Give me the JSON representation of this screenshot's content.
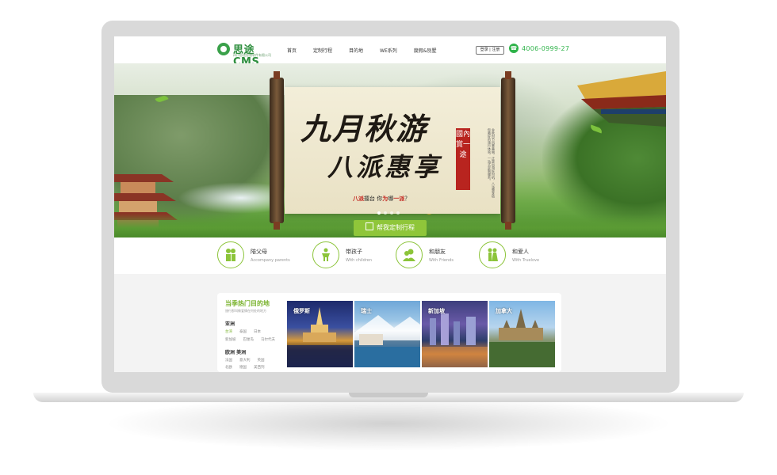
{
  "header": {
    "logo_text": "思途CMS",
    "logo_sub": "四川思途智旅软件有限公司",
    "nav": [
      "首页",
      "定制行程",
      "目的地",
      "WE系列",
      "度假&别墅"
    ],
    "login_label": "登录 | 注册",
    "phone": "4006-0999-27"
  },
  "banner": {
    "title_line1": "九月秋游",
    "title_line2": "八派惠享",
    "seal_text": "國內賞一途",
    "poem": "金秋时节风景美丽，正是出游好时机，八派惠享给你最好的旅行体验，一站式定制服务。",
    "tagline_prefix": "八派",
    "tagline_mid": "擂台   你",
    "tagline_red2": "为",
    "tagline_after": "哪",
    "tagline_red3": "一派",
    "tagline_end": "？",
    "cta_label": "帮我定制行程",
    "slide_count": 4,
    "active_slide": 1
  },
  "categories": [
    {
      "name": "陪父母",
      "sub": "Accompany parents",
      "icon": "parents-icon"
    },
    {
      "name": "带孩子",
      "sub": "With children",
      "icon": "child-icon"
    },
    {
      "name": "和朋友",
      "sub": "With Friends",
      "icon": "friends-icon"
    },
    {
      "name": "和爱人",
      "sub": "With Truelove",
      "icon": "couple-icon"
    }
  ],
  "hot": {
    "title": "当季热门目的地",
    "subtitle": "旅行那叫做爱情在何处的地方",
    "regions": [
      {
        "name": "亚洲",
        "rows": [
          [
            "台湾",
            "泰国",
            "日本"
          ],
          [
            "新加坡",
            "巴厘岛",
            "马尔代夫"
          ]
        ]
      },
      {
        "name": "欧洲 美洲",
        "rows": [
          [
            "法国",
            "意大利",
            "英国"
          ],
          [
            "北欧",
            "德国",
            "美西列"
          ]
        ]
      }
    ],
    "destinations": [
      "俄罗斯",
      "瑞士",
      "新加坡",
      "加拿大"
    ]
  },
  "colors": {
    "brand_green": "#8fc63a",
    "phone_green": "#2fb34a",
    "seal_red": "#b8241f"
  }
}
